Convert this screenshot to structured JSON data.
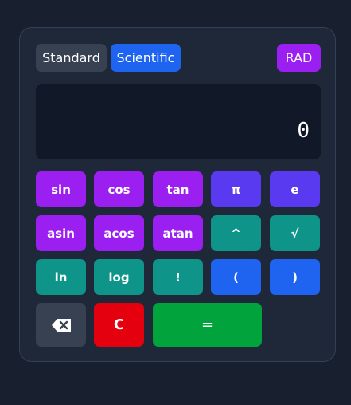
{
  "modes": {
    "standard_label": "Standard",
    "scientific_label": "Scientific",
    "active": "Scientific"
  },
  "angle_unit": "RAD",
  "display": {
    "value": "0"
  },
  "keys": {
    "sin": "sin",
    "cos": "cos",
    "tan": "tan",
    "pi": "π",
    "e": "e",
    "asin": "asin",
    "acos": "acos",
    "atan": "atan",
    "power": "^",
    "sqrt": "√",
    "ln": "ln",
    "log": "log",
    "factorial": "!",
    "open_paren": "(",
    "close_paren": ")",
    "backspace_icon": "backspace-icon",
    "clear": "C",
    "equals": "="
  },
  "colors": {
    "background": "#182030",
    "panel": "#1f2838",
    "display": "#111827",
    "trig": "#9b1ff0",
    "constant": "#5a3af0",
    "function": "#0e9488",
    "paren": "#1e64f0",
    "backspace": "#374151",
    "clear": "#e5000f",
    "equals": "#00a33c"
  }
}
